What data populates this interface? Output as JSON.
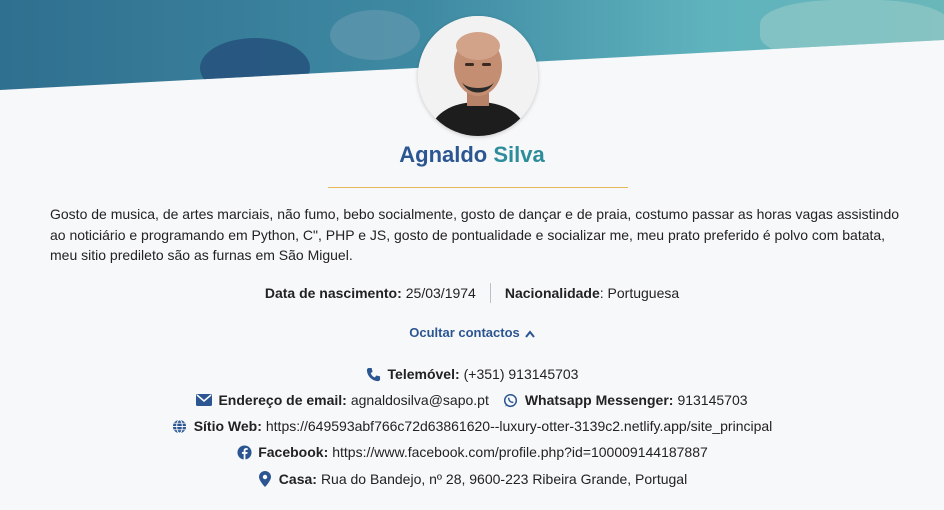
{
  "profile": {
    "first_name": "Agnaldo",
    "last_name": "Silva",
    "bio": "Gosto de musica, de artes marciais, não fumo, bebo socialmente, gosto de dançar e de praia, costumo passar as horas vagas assistindo ao noticiário e programando em Python, C\", PHP e JS, gosto de pontualidade e socializar me, meu prato preferido é polvo com batata, meu sitio predileto são as furnas em São Miguel."
  },
  "facts": {
    "birth_label": "Data de nascimento:",
    "birth_value": "25/03/1974",
    "nationality_label": "Nacionalidade",
    "nationality_value": ": Portuguesa"
  },
  "toggle": {
    "label": "Ocultar contactos"
  },
  "contacts": {
    "phone_label": "Telemóvel:",
    "phone_value": "(+351) 913145703",
    "email_label": "Endereço de email:",
    "email_value": "agnaldosilva@sapo.pt",
    "whatsapp_label": "Whatsapp Messenger:",
    "whatsapp_value": "913145703",
    "website_label": "Sítio Web:",
    "website_value": "https://649593abf766c72d63861620--luxury-otter-3139c2.netlify.app/site_principal",
    "facebook_label": "Facebook:",
    "facebook_value": "https://www.facebook.com/profile.php?id=100009144187887",
    "home_label": "Casa:",
    "home_value": "Rua do Bandejo, nº 28, 9600-223 Ribeira Grande, Portugal"
  },
  "colors": {
    "primary": "#2c5692",
    "accent": "#2e8d9b",
    "divider": "#e3b95a"
  },
  "icons": [
    "phone-icon",
    "envelope-icon",
    "whatsapp-icon",
    "globe-icon",
    "facebook-icon",
    "map-pin-icon",
    "chevron-up-icon"
  ]
}
